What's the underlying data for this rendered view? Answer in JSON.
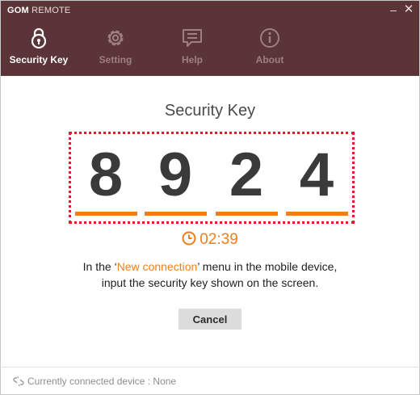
{
  "window": {
    "title_bold": "GOM",
    "title_light": "REMOTE",
    "minimize_glyph": "–",
    "close_glyph": "✕"
  },
  "nav": {
    "tabs": [
      {
        "label": "Security Key",
        "icon": "lock-icon",
        "active": true
      },
      {
        "label": "Setting",
        "icon": "gear-icon",
        "active": false
      },
      {
        "label": "Help",
        "icon": "help-chat-icon",
        "active": false
      },
      {
        "label": "About",
        "icon": "info-icon",
        "active": false
      }
    ]
  },
  "main": {
    "title": "Security Key",
    "key_digits": [
      "8",
      "9",
      "2",
      "4"
    ],
    "timer": "02:39",
    "instruction_before": "In the ‘",
    "instruction_highlight": "New connection",
    "instruction_after": "’ menu in the mobile device,",
    "instruction_line2": "input the security key shown on the screen.",
    "cancel_label": "Cancel"
  },
  "footer": {
    "connected_text": "Currently connected device : None"
  },
  "colors": {
    "header_bg": "#5b3437",
    "accent_orange": "#ee7f1e",
    "dotted_border": "#d8202b",
    "inactive_tab": "#9e7f81"
  }
}
